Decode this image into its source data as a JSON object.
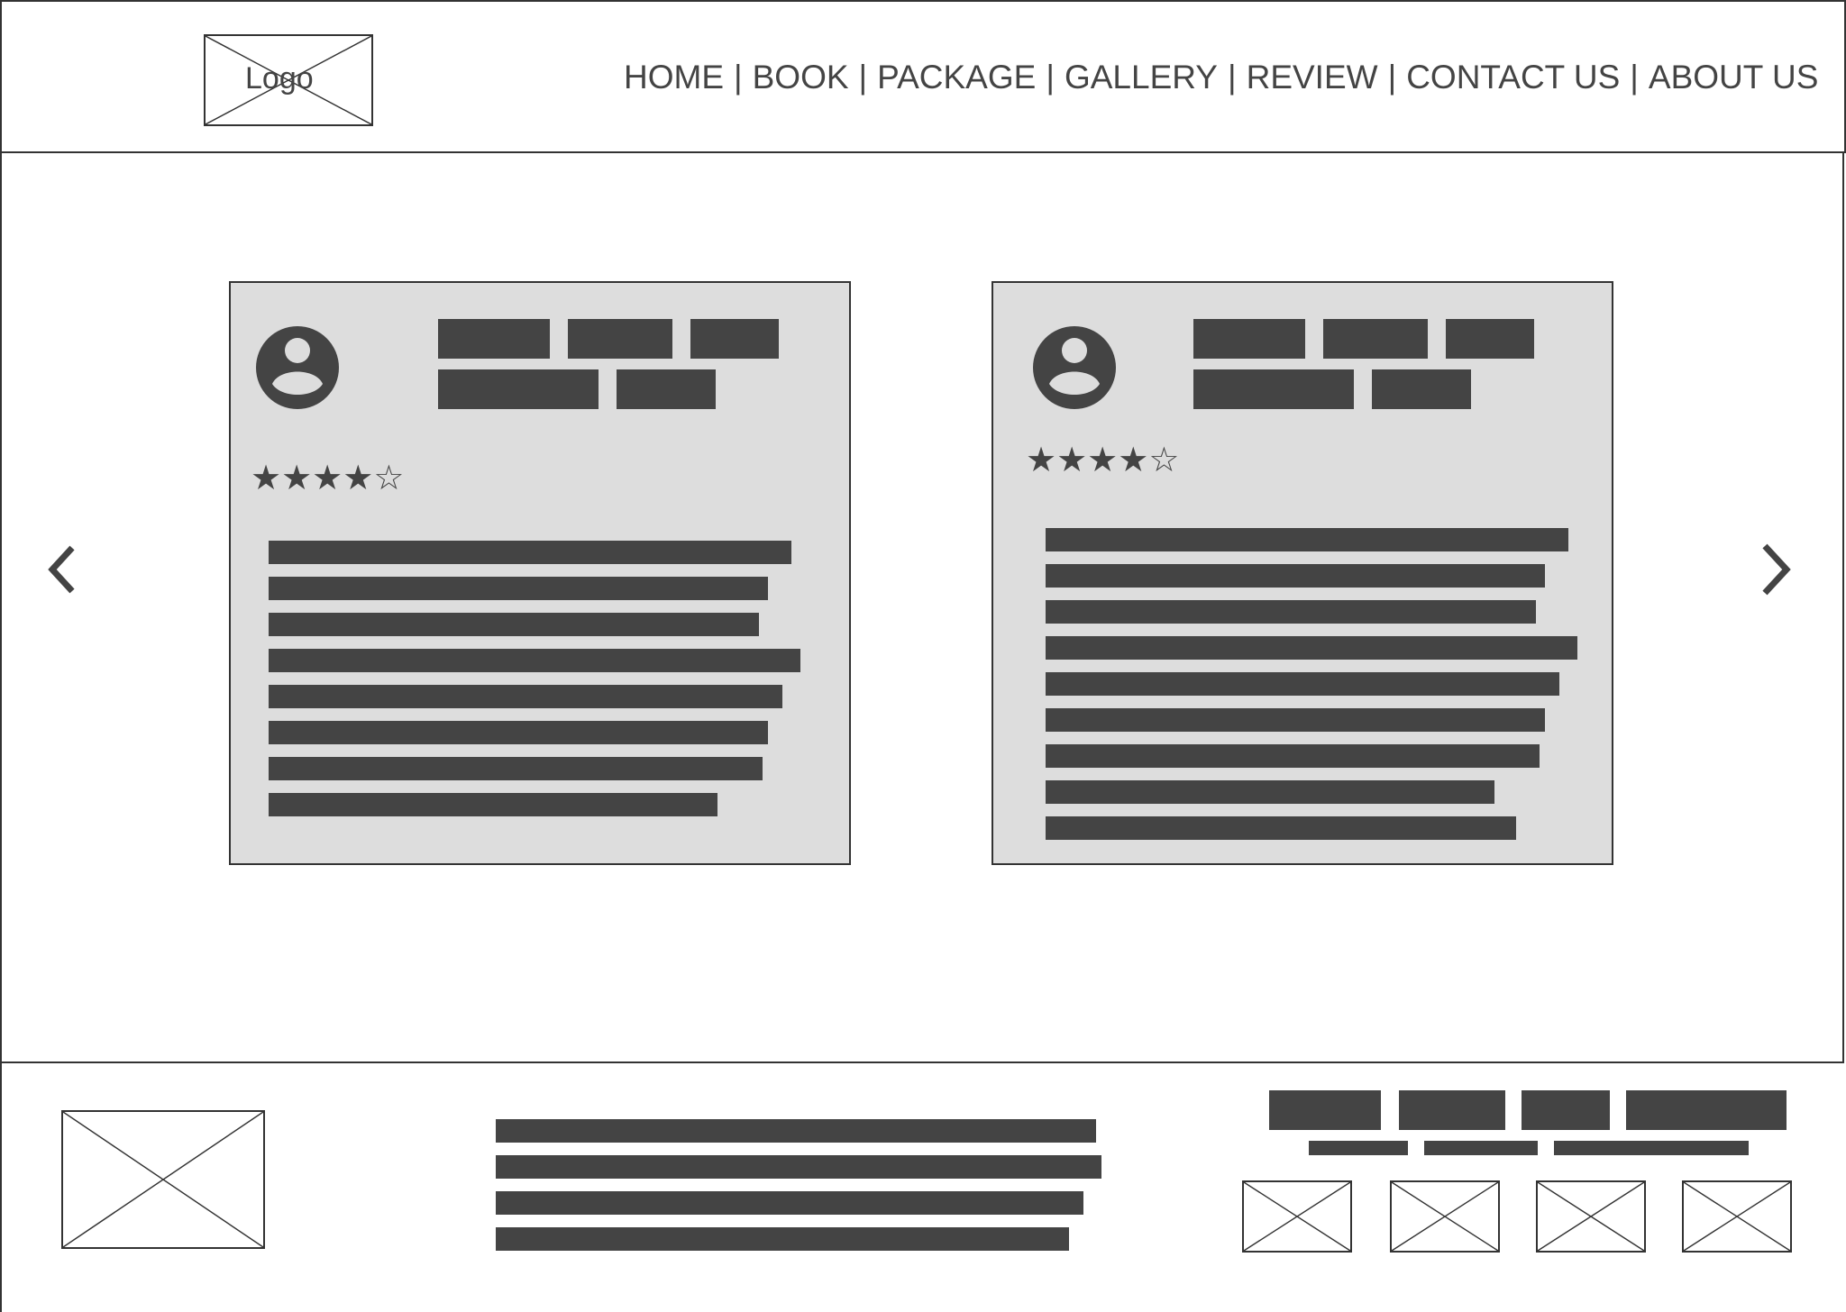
{
  "header": {
    "logo_label": "Logo",
    "nav": [
      "HOME",
      "BOOK",
      "PACKAGE",
      "GALLERY",
      "REVIEW",
      "CONTACT US",
      "ABOUT US"
    ],
    "nav_separator": "|"
  },
  "reviews": [
    {
      "rating": 4,
      "max_rating": 5
    },
    {
      "rating": 4,
      "max_rating": 5
    }
  ],
  "carousel": {
    "prev_icon": "chevron-left-icon",
    "next_icon": "chevron-right-icon"
  },
  "colors": {
    "placeholder_fill": "#444444",
    "card_background": "#dddddd",
    "border": "#333333"
  }
}
